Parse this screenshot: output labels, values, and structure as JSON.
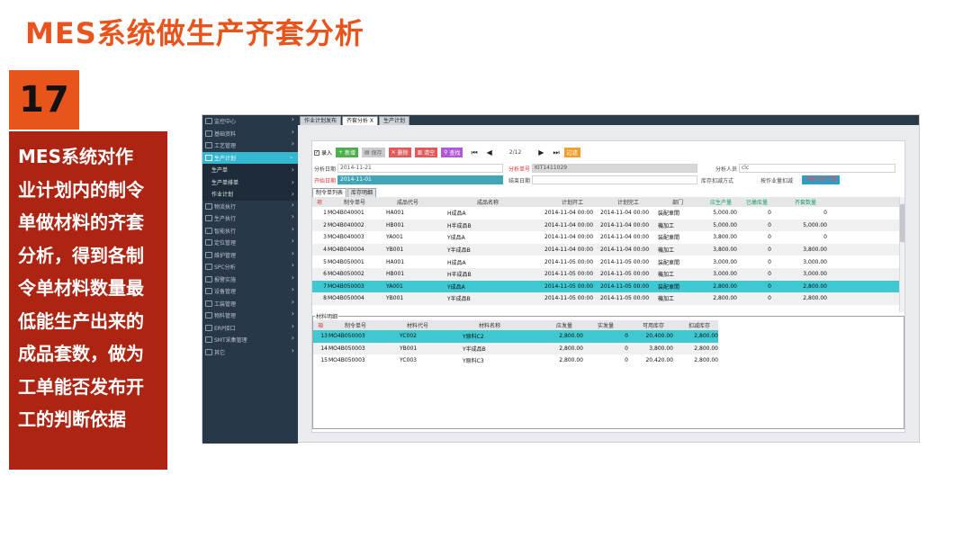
{
  "slide": {
    "title": "MES系统做生产齐套分析",
    "number": "17",
    "description_lines": [
      "MES系统对作",
      "业计划内的制令",
      "单做材料的齐套",
      "分析，得到各制",
      "令单材料数量最",
      "低能生产出来的",
      "成品套数，做为",
      "工单能否发布开",
      "工的判断依据"
    ]
  },
  "sidebar": {
    "items": [
      {
        "label": "监控中心"
      },
      {
        "label": "基础资料"
      },
      {
        "label": "工艺管理"
      },
      {
        "label": "生产计划",
        "active": true
      },
      {
        "label": "物流执行"
      },
      {
        "label": "生产执行"
      },
      {
        "label": "智能执行"
      },
      {
        "label": "定位管理"
      },
      {
        "label": "维护管理"
      },
      {
        "label": "SPC分析"
      },
      {
        "label": "报警实施"
      },
      {
        "label": "设备管理"
      },
      {
        "label": "工装管理"
      },
      {
        "label": "物料管理"
      },
      {
        "label": "ERP接口"
      },
      {
        "label": "SMT采集管理"
      },
      {
        "label": "其它"
      }
    ],
    "sub_items": [
      {
        "label": "生产单"
      },
      {
        "label": "生产单排单"
      },
      {
        "label": "作业计划"
      }
    ]
  },
  "tabs": [
    {
      "label": "作业计划发布"
    },
    {
      "label": "齐套分析 X",
      "active": true
    },
    {
      "label": "生产计划"
    }
  ],
  "toolbar": {
    "entry_label": "录入",
    "add": "新增",
    "save": "保存",
    "delete": "删除",
    "clear": "清空",
    "query": "查找",
    "page_info": "2/12",
    "filter": "过滤"
  },
  "form": {
    "analysis_date_label": "分析日期",
    "analysis_date_value": "2014-11-21",
    "analysis_no_label": "分析单号",
    "analysis_no_value": "KIT1411029",
    "analyst_label": "分析人员",
    "analyst_value": "clc",
    "start_date_label": "开始日期",
    "start_date_value": "2014-11-01",
    "end_date_label": "结束日期",
    "end_date_value": "",
    "deduct_label": "库存扣减方式",
    "by_order_label": "按作业量扣减",
    "calc_button": "齐套分析计算"
  },
  "subtabs": [
    {
      "label": "制令单列表",
      "active": true
    },
    {
      "label": "库存明细"
    }
  ],
  "orders": {
    "columns": [
      "项",
      "制令单号",
      "成品代号",
      "成品名称",
      "计划开工",
      "计划完工",
      "部门",
      "应生产量",
      "已缴库量",
      "齐套数量"
    ],
    "rows": [
      [
        "1",
        "MO4B040001",
        "HA001",
        "H成品A",
        "2014-11-04 00:00",
        "2014-11-04 00:00",
        "装配車間",
        "5,000.00",
        "0",
        "0"
      ],
      [
        "2",
        "MO4B040002",
        "HB001",
        "H半成品B",
        "2014-11-04 00:00",
        "2014-11-04 00:00",
        "機加工",
        "5,000.00",
        "0",
        "5,000.00"
      ],
      [
        "3",
        "MO4B040003",
        "YA001",
        "Y成品A",
        "2014-11-04 00:00",
        "2014-11-04 00:00",
        "装配車間",
        "3,800.00",
        "0",
        "0"
      ],
      [
        "4",
        "MO4B040004",
        "YB001",
        "Y半成品B",
        "2014-11-04 00:00",
        "2014-11-04 00:00",
        "機加工",
        "3,800.00",
        "0",
        "3,800.00"
      ],
      [
        "5",
        "MO4B050001",
        "HA001",
        "H成品A",
        "2014-11-05 00:00",
        "2014-11-05 00:00",
        "装配車間",
        "3,000.00",
        "0",
        "3,000.00"
      ],
      [
        "6",
        "MO4B050002",
        "HB001",
        "H半成品B",
        "2014-11-05 00:00",
        "2014-11-05 00:00",
        "機加工",
        "3,000.00",
        "0",
        "3,000.00"
      ],
      [
        "7",
        "MO4B050003",
        "YA001",
        "Y成品A",
        "2014-11-05 00:00",
        "2014-11-05 00:00",
        "装配車間",
        "2,800.00",
        "0",
        "2,800.00"
      ],
      [
        "8",
        "MO4B050004",
        "YB001",
        "Y半成品B",
        "2014-11-05 00:00",
        "2014-11-05 00:00",
        "機加工",
        "2,800.00",
        "0",
        "2,800.00"
      ]
    ],
    "selected_index": 6
  },
  "materials": {
    "legend": "材料明细",
    "columns": [
      "項",
      "制令单号",
      "材料代号",
      "材料名称",
      "应发量",
      "实发量",
      "可用库存",
      "扣减库存"
    ],
    "rows": [
      [
        "13",
        "MO4B050003",
        "YC002",
        "Y原料C2",
        "2,800.00",
        "0",
        "20,400.00",
        "2,800.00"
      ],
      [
        "14",
        "MO4B050003",
        "YB001",
        "Y半成品B",
        "2,800.00",
        "0",
        "3,800.00",
        "2,800.00"
      ],
      [
        "15",
        "MO4B050003",
        "YC003",
        "Y原料C3",
        "2,800.00",
        "0",
        "20,420.00",
        "2,800.00"
      ]
    ],
    "selected_index": 0
  }
}
